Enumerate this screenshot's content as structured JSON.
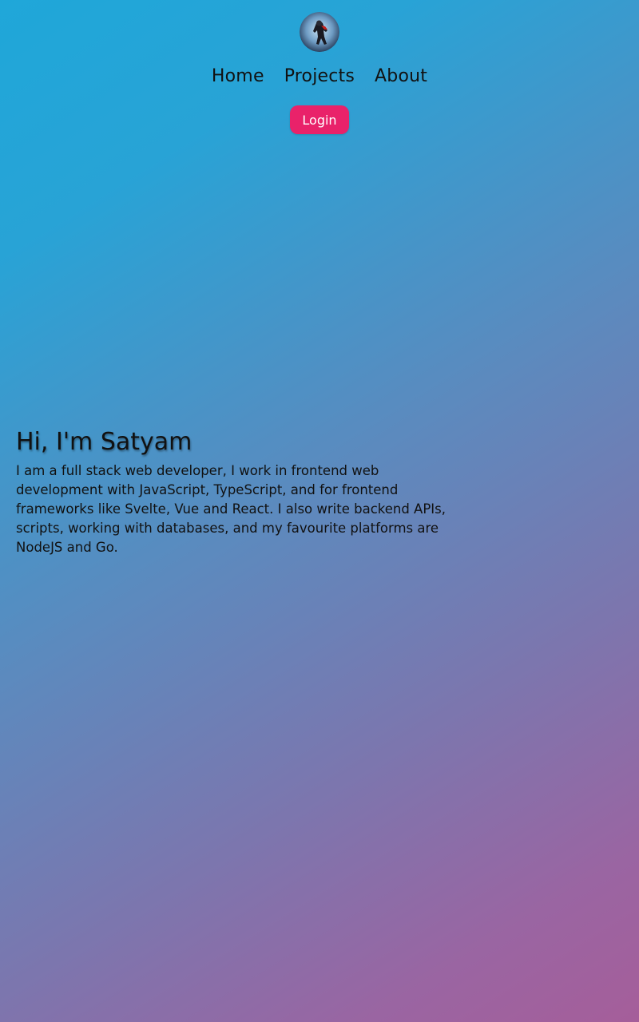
{
  "header": {
    "avatar_icon": "astronaut-avatar",
    "nav": [
      {
        "label": "Home"
      },
      {
        "label": "Projects"
      },
      {
        "label": "About"
      }
    ],
    "login_label": "Login"
  },
  "hero": {
    "heading": "Hi, I'm Satyam",
    "description": "I am a full stack web developer, I work in frontend web development with JavaScript, TypeScript, and for frontend frameworks like Svelte, Vue and React. I also write backend APIs, scripts, working with databases, and my favourite platforms are NodeJS and Go."
  },
  "colors": {
    "accent": "#e9226a",
    "gradient_start": "#1fa7d9",
    "gradient_end": "#a55e9a"
  }
}
